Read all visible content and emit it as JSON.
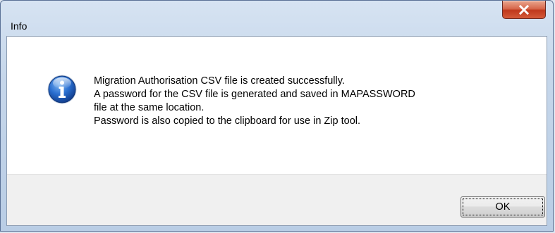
{
  "window": {
    "title": "Info",
    "close_icon": "close-x-icon"
  },
  "dialog": {
    "icon": "info-icon",
    "message_lines": [
      "Migration Authorisation CSV file is created successfully.",
      "A password for the CSV file is generated and saved in MAPASSWORD",
      "file at the same location.",
      "Password is also copied to the clipboard for use in Zip tool."
    ]
  },
  "buttons": {
    "ok_label": "OK"
  },
  "colors": {
    "close_button": "#c7432a",
    "info_icon_blue": "#1f5fb8",
    "button_area": "#f0f0f0"
  }
}
